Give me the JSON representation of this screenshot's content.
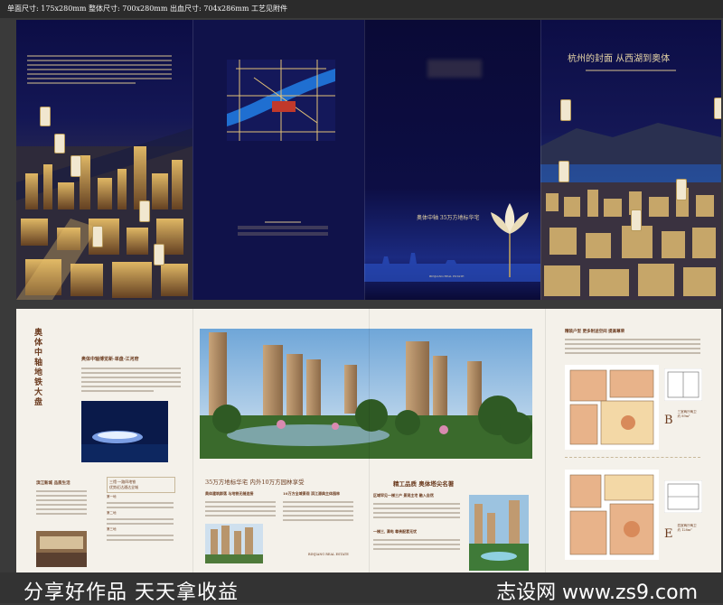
{
  "spec_line": "单面尺寸: 175x280mm  整体尺寸: 700x280mm  出血尺寸: 704x286mm  工艺见附件",
  "outside": {
    "right_slogan": "杭州的封面 从西湖到奥体",
    "center_slogan": "奥体中轴 35万方地标华宅",
    "cover_brand": "BINJIANG REAL ESTATE"
  },
  "inside": {
    "left_vertical_title": "奥体中轴 地铁大盘",
    "left_heading": "奥体中轴博览新·单盘·江河府",
    "left_sub_heading": "滨江新城  品质生活",
    "left_box_lines": [
      "三馆·一路四地铁",
      "优势近达通达全城"
    ],
    "left_list": [
      "第一地",
      "第二地",
      "第三地"
    ],
    "mid_headline_left": "35万方地标华宅 内外10万方园林享受",
    "mid_sub_a": "奥体建筑群落 与地铁无缝连接",
    "mid_sub_b": "10万方全域景观 滨江源典主体园林",
    "mid_logo": "BINJIANG REAL ESTATE",
    "right_headline": "精工品质 奥体塔尖名著",
    "right_sub_a": "区域罕见一梯三户 景观主宅 融入自然",
    "right_sub_b": "一梯三, 满电 尊贵配套无忧",
    "plans_heading": "精装户型  更多附送空间  提高尊荣",
    "plan_b_letter": "B",
    "plan_b_label": "三室两厅两卫",
    "plan_b_area": "约 89m²",
    "plan_e_letter": "E",
    "plan_e_label": "四室两厅两卫",
    "plan_e_area": "约 128m²"
  },
  "watermark": {
    "left": "分享好作品 天天拿收益",
    "right": "志设网 www.zs9.com"
  }
}
